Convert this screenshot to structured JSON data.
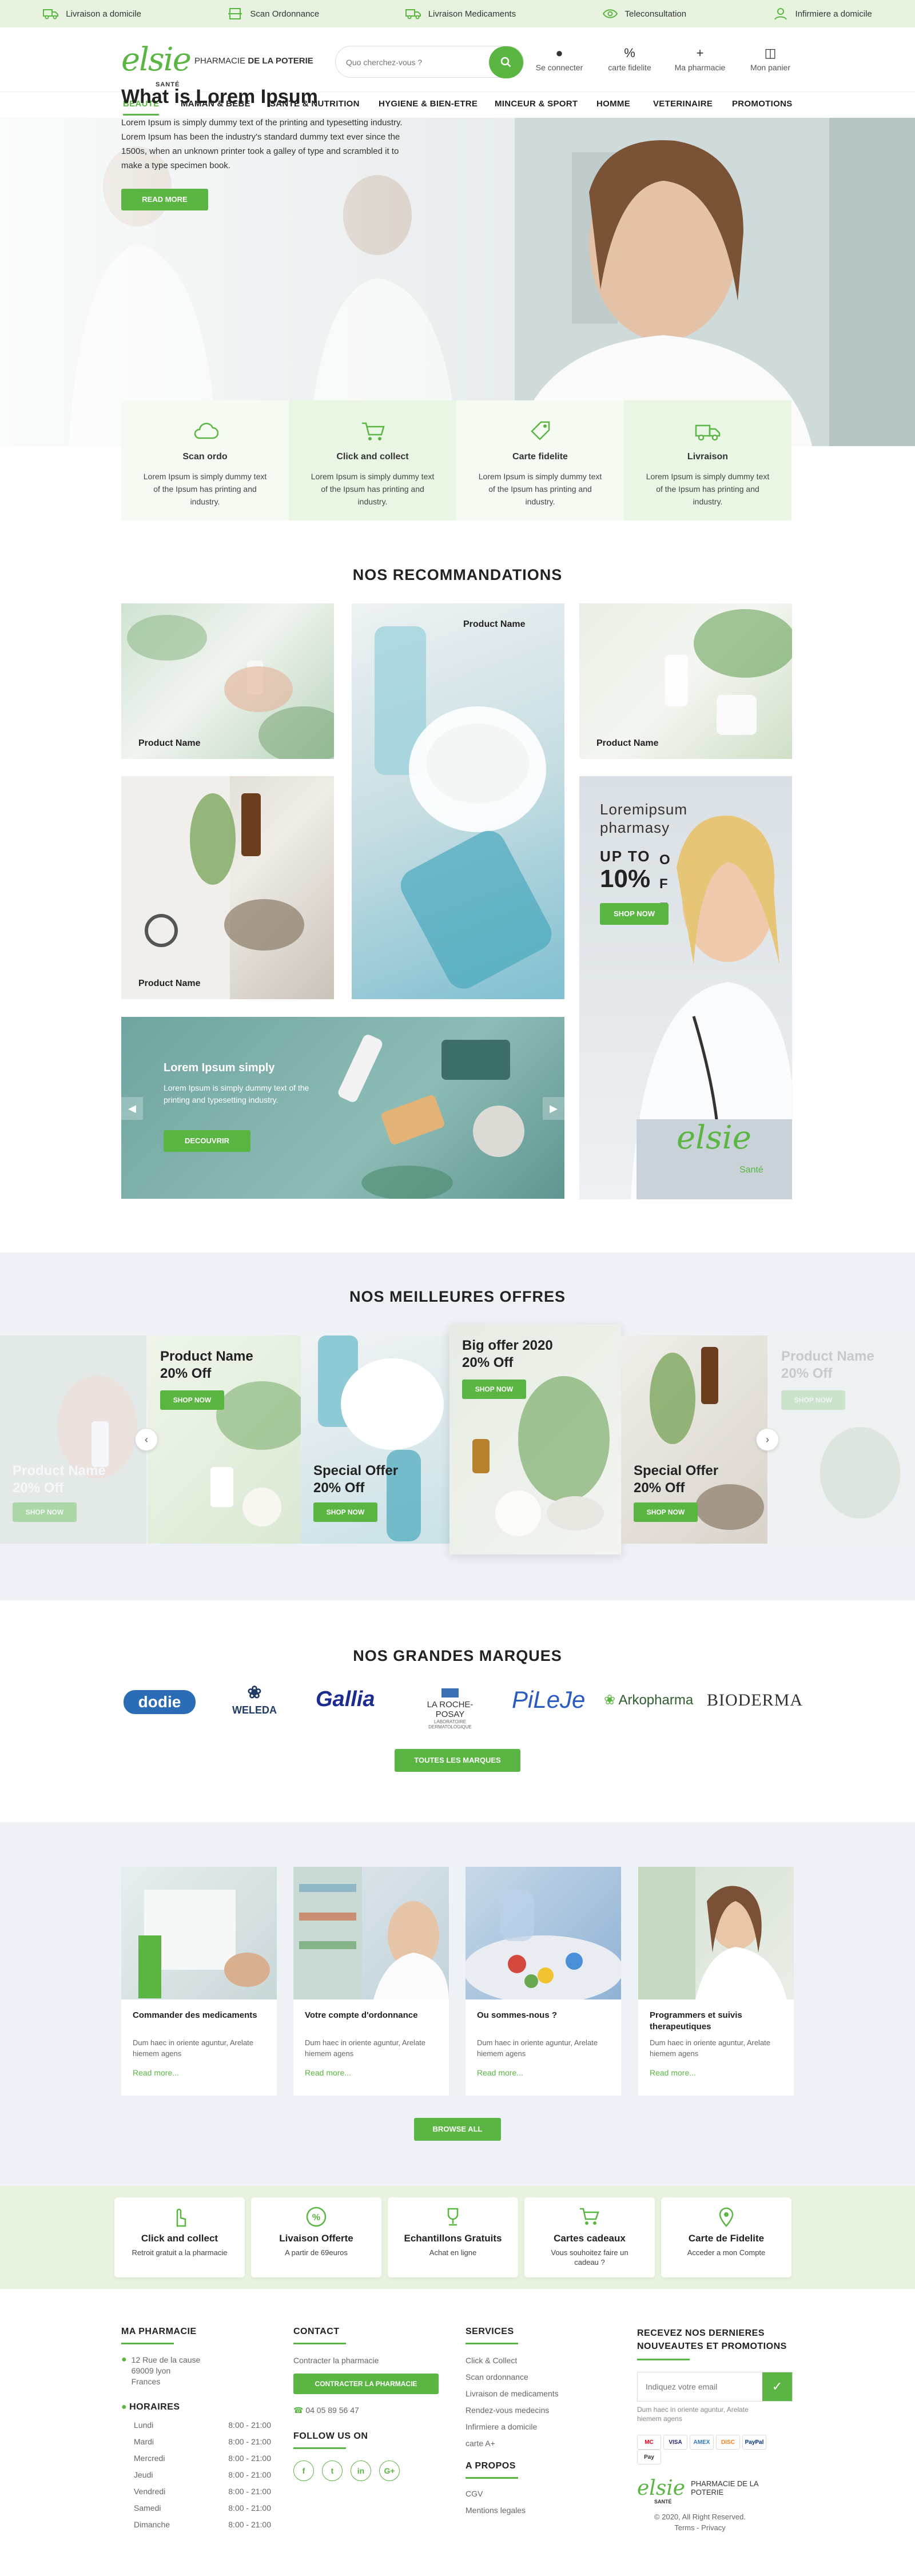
{
  "topbar": {
    "items": [
      {
        "label": "Livraison a domicile",
        "icon": "truck-icon"
      },
      {
        "label": "Scan Ordonnance",
        "icon": "scan-icon"
      },
      {
        "label": "Livraison Medicaments",
        "icon": "truck-icon"
      },
      {
        "label": "Teleconsultation",
        "icon": "eye-icon"
      },
      {
        "label": "Infirmiere a domicile",
        "icon": "nurse-icon"
      }
    ]
  },
  "header": {
    "logo": "elsie",
    "logo_sub": "SANTÉ",
    "pharmacy_prefix": "PHARMACIE",
    "pharmacy_name": "DE LA POTERIE",
    "search_placeholder": "Quo cherchez-vous ?",
    "actions": [
      {
        "label": "Se connecter",
        "icon": "user-icon"
      },
      {
        "label": "carte fidelite",
        "icon": "percent-icon"
      },
      {
        "label": "Ma pharmacie",
        "icon": "plus-icon"
      },
      {
        "label": "Mon panier",
        "icon": "basket-icon"
      }
    ]
  },
  "nav": {
    "items": [
      "BEAUTE",
      "MAMAN & BEBE",
      "SANTE & NUTRITION",
      "HYGIENE & BIEN-ETRE",
      "MINCEUR & SPORT",
      "HOMME",
      "VETERINAIRE",
      "PROMOTIONS"
    ],
    "active": "BEAUTE"
  },
  "hero": {
    "title": "What is Lorem Ipsum",
    "text": "Lorem Ipsum is simply dummy text of the printing and typesetting industry. Lorem Ipsum has been the industry's standard dummy text ever since the 1500s, when an unknown printer took a galley of type and scrambled it to make a type specimen book.",
    "button": "READ MORE"
  },
  "features": [
    {
      "title": "Scan ordo",
      "text": "Lorem Ipsum is simply dummy text of the Ipsum has printing and industry.",
      "icon": "cloud-icon"
    },
    {
      "title": "Click and collect",
      "text": "Lorem Ipsum is simply dummy text of the Ipsum has printing and industry.",
      "icon": "cart-icon"
    },
    {
      "title": "Carte fidelite",
      "text": "Lorem Ipsum is simply dummy text of the Ipsum has printing and industry.",
      "icon": "tag-icon"
    },
    {
      "title": "Livraison",
      "text": "Lorem Ipsum is simply dummy text of the Ipsum has printing and industry.",
      "icon": "truck-icon"
    }
  ],
  "recommandations": {
    "title": "NOS RECOMMANDATIONS",
    "product_label": "Product Name",
    "promo": {
      "line1": "Loremipsum",
      "line2": "pharmasy",
      "upto": "UP TO",
      "pct": "10%",
      "off": "OFF",
      "button": "SHOP NOW",
      "brand": "elsie",
      "brand_sub": "Santé"
    },
    "slider": {
      "title": "Lorem Ipsum simply",
      "text": "Lorem Ipsum is simply dummy text of the printing and typesetting industry.",
      "button": "DECOUVRIR"
    }
  },
  "offers": {
    "title": "NOS MEILLEURES OFFRES",
    "cards": [
      {
        "title": "Product Name",
        "sub": "20% Off",
        "button": "SHOP NOW"
      },
      {
        "title": "Product Name",
        "sub": "20% Off",
        "button": "SHOP NOW"
      },
      {
        "title": "Special Offer",
        "sub": "20% Off",
        "button": "SHOP NOW"
      },
      {
        "title": "Big offer 2020",
        "sub": "20% Off",
        "button": "SHOP NOW"
      },
      {
        "title": "Special Offer",
        "sub": "20% Off",
        "button": "SHOP NOW"
      },
      {
        "title": "Product Name",
        "sub": "20% Off",
        "button": "SHOP NOW"
      }
    ]
  },
  "brands": {
    "title": "NOS GRANDES MARQUES",
    "items": [
      "dodie",
      "WELEDA",
      "Gallia",
      "LA ROCHE-POSAY",
      "PiLeJe",
      "Arkopharma",
      "BIODERMA"
    ],
    "roche_sub": "LABORATOIRE DERMATOLOGIQUE",
    "button": "TOUTES LES MARQUES"
  },
  "services": {
    "cards": [
      {
        "title": "Commander des medicaments",
        "text": "Dum haec in oriente aguntur, Arelate hiemem agens",
        "link": "Read more..."
      },
      {
        "title": "Votre compte d'ordonnance",
        "text": "Dum haec in oriente aguntur, Arelate hiemem agens",
        "link": "Read more..."
      },
      {
        "title": "Ou sommes-nous ?",
        "text": "Dum haec in oriente aguntur, Arelate hiemem agens",
        "link": "Read more..."
      },
      {
        "title": "Programmers et suivis therapeutiques",
        "text": "Dum haec in oriente aguntur, Arelate hiemem agens",
        "link": "Read more..."
      }
    ],
    "button": "BROWSE ALL"
  },
  "bottom_features": [
    {
      "title": "Click and collect",
      "text": "Retroit gratuit a la pharmacie",
      "icon": "hand-icon"
    },
    {
      "title": "Livaison Offerte",
      "text": "A partir de 69euros",
      "icon": "percent-badge-icon"
    },
    {
      "title": "Echantillons Gratuits",
      "text": "Achat en ligne",
      "icon": "trophy-icon"
    },
    {
      "title": "Cartes cadeaux",
      "text": "Vous souhoitez faire un cadeau ?",
      "icon": "cart-icon"
    },
    {
      "title": "Carte de Fidelite",
      "text": "Acceder a mon Compte",
      "icon": "map-pin-icon"
    }
  ],
  "footer": {
    "pharma": {
      "title": "MA PHARMACIE",
      "address": [
        "12 Rue de la cause",
        "69009 lyon",
        "Frances"
      ],
      "hours_title": "HORAIRES",
      "hours": [
        {
          "day": "Lundi",
          "time": "8:00 - 21:00"
        },
        {
          "day": "Mardi",
          "time": "8:00 - 21:00"
        },
        {
          "day": "Mercredi",
          "time": "8:00 - 21:00"
        },
        {
          "day": "Jeudi",
          "time": "8:00 - 21:00"
        },
        {
          "day": "Vendredi",
          "time": "8:00 - 21:00"
        },
        {
          "day": "Samedi",
          "time": "8:00 - 21:00"
        },
        {
          "day": "Dimanche",
          "time": "8:00 - 21:00"
        }
      ]
    },
    "contact": {
      "title": "CONTACT",
      "link": "Contracter la pharmacie",
      "button": "CONTRACTER LA PHARMACIE",
      "phone": "04 05 89 56 47",
      "follow": "FOLLOW US ON",
      "socials": [
        "f",
        "t",
        "in",
        "G+"
      ]
    },
    "services": {
      "title": "SERVICES",
      "links": [
        "Click & Collect",
        "Scan ordonnance",
        "Livraison de medicaments",
        "Rendez-vous medecins",
        "Infirmiere a domicile",
        "carte A+"
      ],
      "apropos_title": "A PROPOS",
      "apropos_links": [
        "CGV",
        "Mentions legales"
      ]
    },
    "newsletter": {
      "title": "RECEVEZ NOS DERNIERES NOUVEAUTES ET PROMOTIONS",
      "placeholder": "Indiquez votre email",
      "note": "Dum haec in oriente aguntur, Arelate hiemem agens",
      "payments": [
        "MC",
        "VISA",
        "AMEX",
        "DISC",
        "PayPal",
        "Pay"
      ],
      "logo": "elsie",
      "logo_sub": "SANTÉ",
      "pharmacy": "PHARMACIE DE LA POTERIE",
      "copyright": "© 2020, All Right Reserved.",
      "terms": "Terms - Privacy"
    }
  },
  "colors": {
    "accent": "#5bb543",
    "light_green": "#e7f3df",
    "band": "#eef2f7"
  }
}
